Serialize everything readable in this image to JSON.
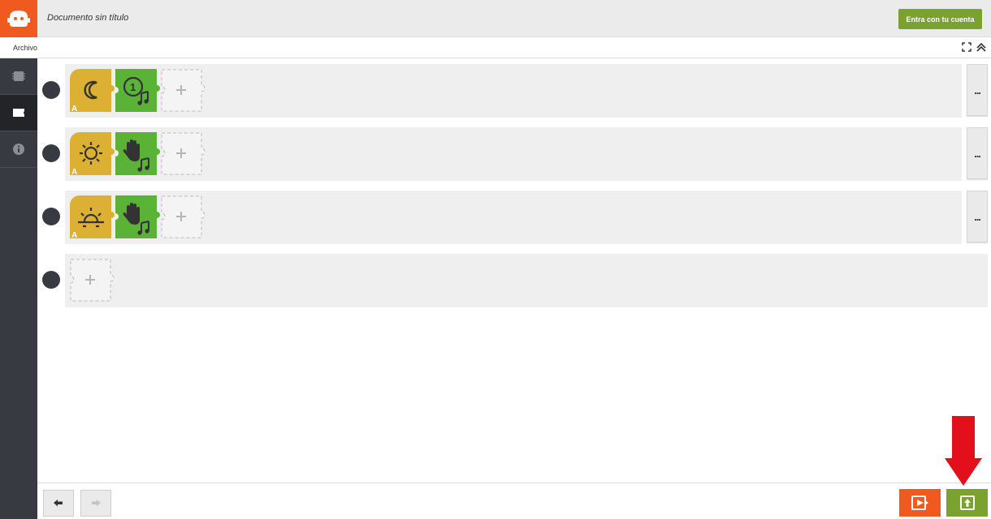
{
  "header": {
    "document_title": "Documento sin título",
    "login_button_label": "Entra con tu cuenta"
  },
  "menu": {
    "archivo_label": "Archivo"
  },
  "sidebar": {
    "items": [
      {
        "name": "hardware",
        "icon": "chip-icon",
        "active": false
      },
      {
        "name": "software",
        "icon": "board-icon",
        "active": true
      },
      {
        "name": "info",
        "icon": "info-icon",
        "active": false
      }
    ]
  },
  "rules": [
    {
      "event_icon": "moon-icon",
      "event_badge": "A",
      "action_icon": "melody-1-icon",
      "action_badge": "1",
      "more_label": "..."
    },
    {
      "event_icon": "sun-icon",
      "event_badge": "A",
      "action_icon": "hand-music-icon",
      "more_label": "..."
    },
    {
      "event_icon": "sunset-icon",
      "event_badge": "A",
      "action_icon": "hand-music-icon",
      "more_label": "..."
    },
    {
      "empty": true
    }
  ],
  "add_symbol": "+",
  "colors": {
    "brand_orange": "#f05a1e",
    "event_yellow": "#dcb033",
    "action_green": "#5ab236",
    "accent_green": "#7ba230",
    "sidebar_dark": "#373a40",
    "arrow_red": "#e3101b"
  }
}
